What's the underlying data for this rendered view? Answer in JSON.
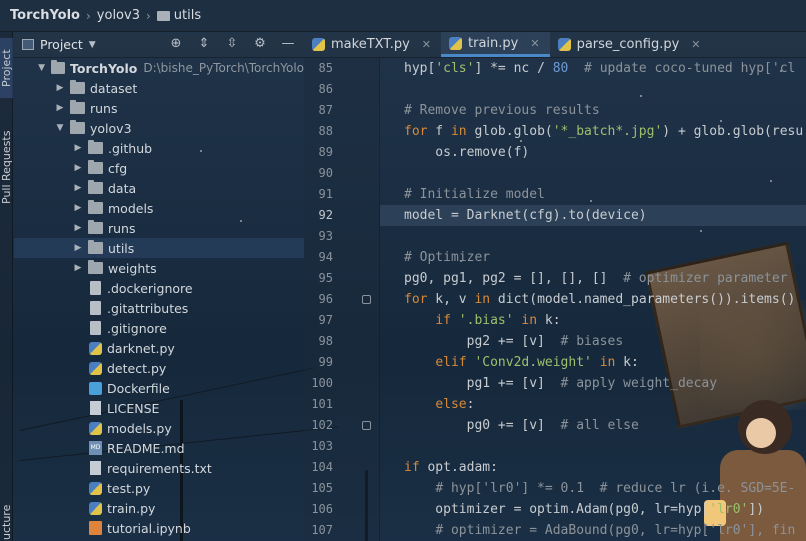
{
  "breadcrumb": [
    {
      "label": "TorchYolo"
    },
    {
      "label": "yolov3"
    },
    {
      "label": "utils"
    }
  ],
  "side_tabs": {
    "project": "Project",
    "pull_requests": "Pull Requests",
    "structure": "ucture"
  },
  "project_panel": {
    "title": "Project"
  },
  "tree": {
    "root_label": "TorchYolo",
    "root_path": "D:\\bishe_PyTorch\\TorchYolo",
    "items": [
      {
        "label": "dataset",
        "type": "folder",
        "expanded": false
      },
      {
        "label": "runs",
        "type": "folder",
        "expanded": false
      },
      {
        "label": "yolov3",
        "type": "folder",
        "expanded": true
      },
      {
        "label": ".github",
        "type": "folder",
        "expanded": false
      },
      {
        "label": "cfg",
        "type": "folder",
        "expanded": false
      },
      {
        "label": "data",
        "type": "folder",
        "expanded": false
      },
      {
        "label": "models",
        "type": "folder",
        "expanded": false
      },
      {
        "label": "runs",
        "type": "folder",
        "expanded": false
      },
      {
        "label": "utils",
        "type": "folder",
        "expanded": false,
        "selected": true
      },
      {
        "label": "weights",
        "type": "folder",
        "expanded": false
      },
      {
        "label": ".dockerignore",
        "type": "file"
      },
      {
        "label": ".gitattributes",
        "type": "file"
      },
      {
        "label": ".gitignore",
        "type": "file"
      },
      {
        "label": "darknet.py",
        "type": "py"
      },
      {
        "label": "detect.py",
        "type": "py"
      },
      {
        "label": "Dockerfile",
        "type": "docker"
      },
      {
        "label": "LICENSE",
        "type": "txt"
      },
      {
        "label": "models.py",
        "type": "py"
      },
      {
        "label": "README.md",
        "type": "md"
      },
      {
        "label": "requirements.txt",
        "type": "txt"
      },
      {
        "label": "test.py",
        "type": "py"
      },
      {
        "label": "train.py",
        "type": "py"
      },
      {
        "label": "tutorial.ipynb",
        "type": "nb"
      }
    ]
  },
  "editor_tabs": [
    {
      "label": "makeTXT.py",
      "active": false
    },
    {
      "label": "train.py",
      "active": true
    },
    {
      "label": "parse_config.py",
      "active": false
    }
  ],
  "editor": {
    "current_line": 92,
    "lines": [
      {
        "n": 85,
        "text": "hyp['cls'] *= nc / 80  # update coco-tuned hyp['cl"
      },
      {
        "n": 86,
        "text": ""
      },
      {
        "n": 87,
        "text": "# Remove previous results"
      },
      {
        "n": 88,
        "text": "for f in glob.glob('*_batch*.jpg') + glob.glob(resu"
      },
      {
        "n": 89,
        "text": "    os.remove(f)"
      },
      {
        "n": 90,
        "text": ""
      },
      {
        "n": 91,
        "text": "# Initialize model"
      },
      {
        "n": 92,
        "text": "model = Darknet(cfg).to(device)"
      },
      {
        "n": 93,
        "text": ""
      },
      {
        "n": 94,
        "text": "# Optimizer"
      },
      {
        "n": 95,
        "text": "pg0, pg1, pg2 = [], [], []  # optimizer parameter"
      },
      {
        "n": 96,
        "text": "for k, v in dict(model.named_parameters()).items()"
      },
      {
        "n": 97,
        "text": "    if '.bias' in k:"
      },
      {
        "n": 98,
        "text": "        pg2 += [v]  # biases"
      },
      {
        "n": 99,
        "text": "    elif 'Conv2d.weight' in k:"
      },
      {
        "n": 100,
        "text": "        pg1 += [v]  # apply weight_decay"
      },
      {
        "n": 101,
        "text": "    else:"
      },
      {
        "n": 102,
        "text": "        pg0 += [v]  # all else"
      },
      {
        "n": 103,
        "text": ""
      },
      {
        "n": 104,
        "text": "if opt.adam:"
      },
      {
        "n": 105,
        "text": "    # hyp['lr0'] *= 0.1  # reduce lr (i.e. SGD=5E-"
      },
      {
        "n": 106,
        "text": "    optimizer = optim.Adam(pg0, lr=hyp['lr0'])"
      },
      {
        "n": 107,
        "text": "    # optimizer = AdaBound(pg0, lr=hyp['lr0'], fin"
      }
    ]
  }
}
